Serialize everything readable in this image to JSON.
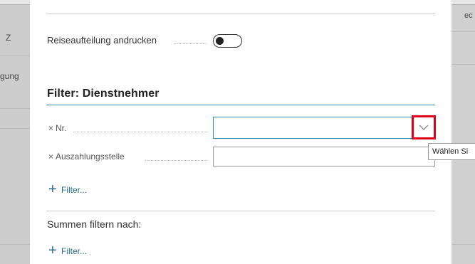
{
  "background": {
    "left_fragment_1": "Z",
    "left_fragment_2": "gung",
    "right_fragment": "ec"
  },
  "dialog": {
    "toggle_row": {
      "label": "Reiseaufteilung andrucken",
      "toggle_state": "off"
    },
    "filter_section": {
      "title": "Filter: Dienstnehmer",
      "fields": [
        {
          "remove_glyph": "×",
          "label": "Nr.",
          "value": ""
        },
        {
          "remove_glyph": "×",
          "label": "Auszahlungsstelle",
          "value": ""
        }
      ],
      "add_filter_label": "Filter..."
    },
    "totals_section": {
      "title": "Summen filtern nach:",
      "add_filter_label": "Filter..."
    },
    "tooltip": "Wählen Si"
  },
  "icons": {
    "dropdown": "chevron-down-icon",
    "add": "plus-icon",
    "remove": "close-icon"
  },
  "colors": {
    "accent_teal": "#2b8fa5",
    "highlight_red": "#e0001a",
    "link_blue": "#2b6f8a"
  }
}
